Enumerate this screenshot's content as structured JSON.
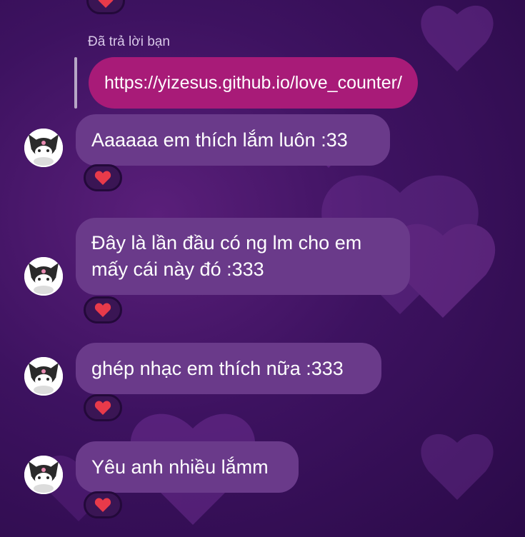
{
  "colors": {
    "background": "#3d1260",
    "incoming_bubble": "#6a3a8a",
    "outgoing_bubble": "#a81b78",
    "reaction_pill": "#3a1554",
    "heart": "#e83a4a"
  },
  "reply_context": {
    "label": "Đã trả lời bạn",
    "quoted_text": "https://yizesus.github.io/love_counter/"
  },
  "messages": [
    {
      "lines": [
        "Aaaaaa em thích lắm luôn :33"
      ],
      "reaction": "heart-icon"
    },
    {
      "lines": [
        "Đây là lần đầu có ng lm cho em",
        "mấy cái này đó :333"
      ],
      "reaction": "heart-icon"
    },
    {
      "lines": [
        "ghép nhạc em thích nữa :333"
      ],
      "reaction": "heart-icon"
    },
    {
      "lines": [
        "Yêu anh nhiều lắmm"
      ],
      "reaction": "heart-icon"
    }
  ]
}
